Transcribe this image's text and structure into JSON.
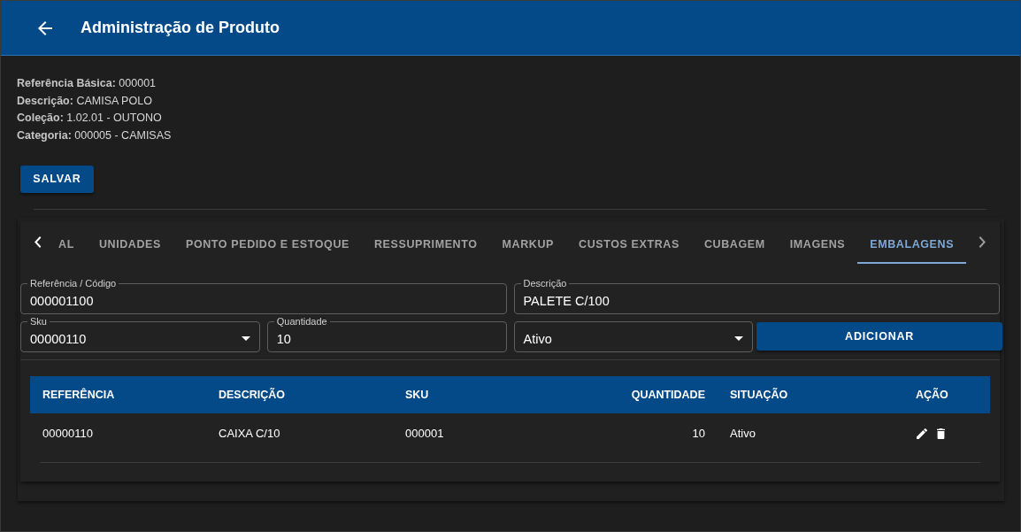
{
  "app_bar": {
    "title": "Administração de Produto"
  },
  "product_info": [
    {
      "label": "Referência Básica:",
      "value": "000001"
    },
    {
      "label": "Descrição:",
      "value": "CAMISA POLO"
    },
    {
      "label": "Coleção:",
      "value": "1.02.01 - OUTONO"
    },
    {
      "label": "Categoria:",
      "value": "000005 - CAMISAS"
    }
  ],
  "save_button": {
    "label": "SALVAR"
  },
  "tabs": [
    {
      "label": "AL",
      "selected": false
    },
    {
      "label": "UNIDADES",
      "selected": false
    },
    {
      "label": "PONTO PEDIDO E ESTOQUE",
      "selected": false
    },
    {
      "label": "RESSUPRIMENTO",
      "selected": false
    },
    {
      "label": "MARKUP",
      "selected": false
    },
    {
      "label": "CUSTOS EXTRAS",
      "selected": false
    },
    {
      "label": "CUBAGEM",
      "selected": false
    },
    {
      "label": "IMAGENS",
      "selected": false
    },
    {
      "label": "EMBALAGENS",
      "selected": true
    }
  ],
  "form": {
    "fields": [
      {
        "kind": "text",
        "label": "Referência / Código",
        "value": "000001100"
      },
      {
        "kind": "text",
        "label": "Descrição",
        "value": "PALETE C/100"
      },
      {
        "kind": "select",
        "label": "Sku",
        "value": "00000110"
      },
      {
        "kind": "text",
        "label": "Quantidade",
        "value": "10"
      },
      {
        "kind": "select",
        "value": "Ativo"
      }
    ],
    "add_button": {
      "label": "ADICIONAR"
    }
  },
  "table": {
    "columns": [
      {
        "label": "REFERÊNCIA",
        "kind": "text"
      },
      {
        "label": "DESCRIÇÃO",
        "kind": "text"
      },
      {
        "label": "SKU",
        "kind": "text"
      },
      {
        "label": "QUANTIDADE",
        "kind": "number"
      },
      {
        "label": "SITUAÇÃO",
        "kind": "text"
      },
      {
        "label": "AÇÃO",
        "kind": "actions"
      }
    ],
    "rows": [
      {
        "cells": [
          "00000110",
          "CAIXA C/10",
          "000001",
          "10",
          "Ativo"
        ]
      }
    ]
  }
}
